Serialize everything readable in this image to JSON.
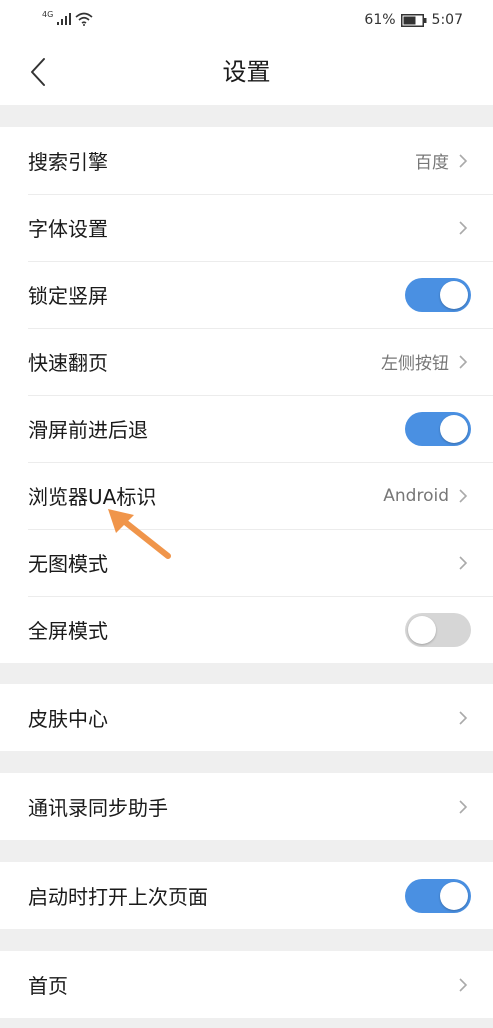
{
  "status_bar": {
    "network": "4G",
    "battery": "61%",
    "time": "5:07"
  },
  "header": {
    "title": "设置",
    "back_icon": "chevron-left-icon"
  },
  "settings": {
    "group1": [
      {
        "label": "搜索引擎",
        "value": "百度",
        "type": "link"
      },
      {
        "label": "字体设置",
        "value": "",
        "type": "link"
      },
      {
        "label": "锁定竖屏",
        "type": "toggle",
        "on": true
      },
      {
        "label": "快速翻页",
        "value": "左侧按钮",
        "type": "link"
      },
      {
        "label": "滑屏前进后退",
        "type": "toggle",
        "on": true
      },
      {
        "label": "浏览器UA标识",
        "value": "Android",
        "type": "link"
      },
      {
        "label": "无图模式",
        "value": "",
        "type": "link"
      },
      {
        "label": "全屏模式",
        "type": "toggle",
        "on": false
      }
    ],
    "group2": [
      {
        "label": "皮肤中心",
        "type": "link"
      }
    ],
    "group3": [
      {
        "label": "通讯录同步助手",
        "type": "link"
      }
    ],
    "group4": [
      {
        "label": "启动时打开上次页面",
        "type": "toggle",
        "on": true
      }
    ],
    "group5": [
      {
        "label": "首页",
        "type": "link"
      }
    ]
  },
  "colors": {
    "toggle_on": "#4a90e2",
    "toggle_off": "#d6d6d6",
    "annotation_arrow": "#f0954a",
    "background": "#efefef"
  }
}
